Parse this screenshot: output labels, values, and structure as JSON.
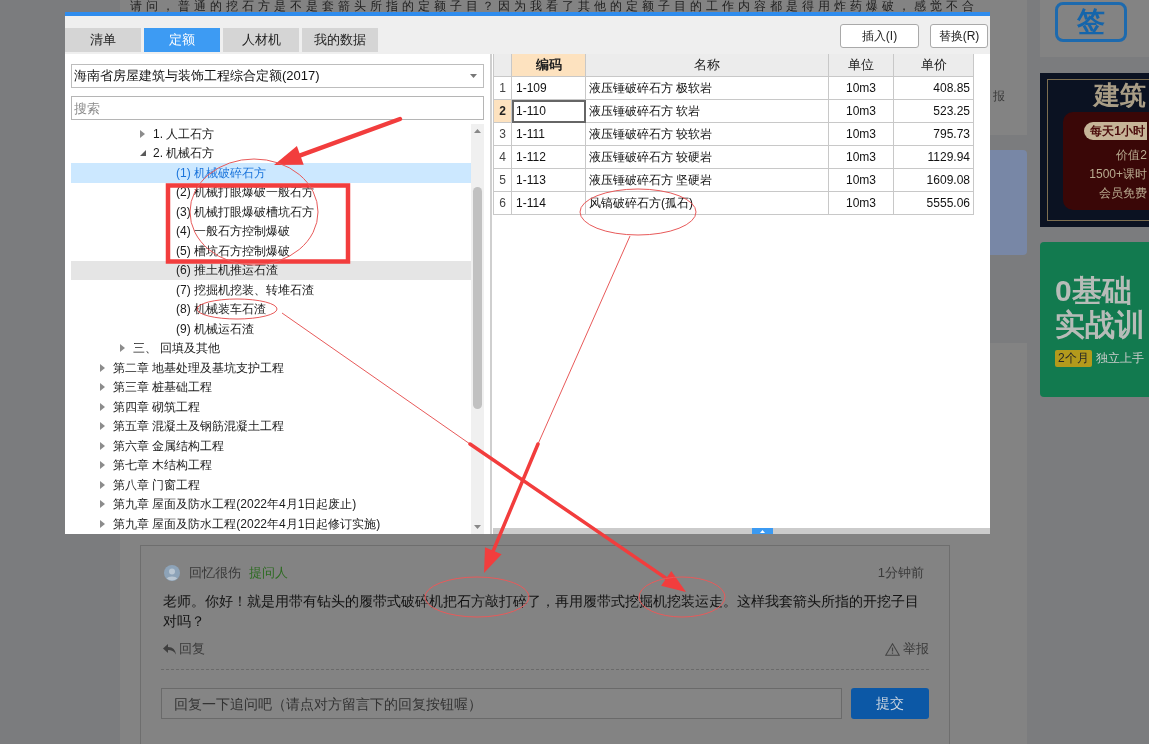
{
  "question": {
    "text": "请问，普通的挖石方是不是套箭头所指的定额子目？因为我看了其他的定额子目的工作内容都是得用炸药爆破，感觉不合",
    "report": "报"
  },
  "sidebar": {
    "sign_in": {
      "label": "签"
    },
    "ads": [
      {
        "kind": "course",
        "title": "建筑",
        "badge": "每天1小时",
        "lines": [
          "价值2",
          "1500+课时",
          "会员免费"
        ]
      },
      {
        "kind": "training",
        "title_lines": [
          "0基础",
          "实战训"
        ],
        "badge": "2个月",
        "subtitle": "独立上手"
      }
    ]
  },
  "screenshot": {
    "tabs": [
      {
        "label": "清单",
        "selected": false
      },
      {
        "label": "定额",
        "selected": true
      },
      {
        "label": "人材机",
        "selected": false
      },
      {
        "label": "我的数据",
        "selected": false
      }
    ],
    "buttons": [
      "插入(I)",
      "替换(R)"
    ],
    "quota_library": {
      "value": "海南省房屋建筑与装饰工程综合定额(2017)"
    },
    "search": {
      "placeholder": "搜索"
    },
    "tree": [
      {
        "children": [
          {
            "children": [
              {
                "label": "1. 人工石方",
                "expanded": false,
                "selected": false,
                "hovered": false
              },
              {
                "label": "2. 机械石方",
                "expanded": true,
                "selected": false,
                "hovered": false,
                "children": [
                  {
                    "label": "(1) 机械破碎石方",
                    "selected": true,
                    "hovered": false
                  },
                  {
                    "label": "(2) 机械打眼爆破一般石方",
                    "selected": false,
                    "hovered": false
                  },
                  {
                    "label": "(3) 机械打眼爆破槽坑石方",
                    "selected": false,
                    "hovered": false
                  },
                  {
                    "label": "(4) 一般石方控制爆破",
                    "selected": false,
                    "hovered": false
                  },
                  {
                    "label": "(5) 槽坑石方控制爆破",
                    "selected": false,
                    "hovered": false
                  },
                  {
                    "label": "(6) 推土机推运石渣",
                    "selected": false,
                    "hovered": true
                  },
                  {
                    "label": "(7) 挖掘机挖装、转堆石渣",
                    "selected": false,
                    "hovered": false
                  },
                  {
                    "label": "(8) 机械装车石渣",
                    "selected": false,
                    "hovered": false
                  },
                  {
                    "label": "(9) 机械运石渣",
                    "selected": false,
                    "hovered": false
                  }
                ]
              }
            ]
          },
          {
            "label": "三、 回填及其他",
            "expanded": false,
            "selected": false,
            "hovered": false
          }
        ]
      },
      {
        "label": "第二章 地基处理及基坑支护工程",
        "expanded": false,
        "selected": false,
        "hovered": false
      },
      {
        "label": "第三章 桩基础工程",
        "expanded": false,
        "selected": false,
        "hovered": false
      },
      {
        "label": "第四章 砌筑工程",
        "expanded": false,
        "selected": false,
        "hovered": false
      },
      {
        "label": "第五章 混凝土及钢筋混凝土工程",
        "expanded": false,
        "selected": false,
        "hovered": false
      },
      {
        "label": "第六章 金属结构工程",
        "expanded": false,
        "selected": false,
        "hovered": false
      },
      {
        "label": "第七章 木结构工程",
        "expanded": false,
        "selected": false,
        "hovered": false
      },
      {
        "label": "第八章 门窗工程",
        "expanded": false,
        "selected": false,
        "hovered": false
      },
      {
        "label": "第九章 屋面及防水工程(2022年4月1日起废止)",
        "expanded": false,
        "selected": false,
        "hovered": false
      },
      {
        "label": "第九章 屋面及防水工程(2022年4月1日起修订实施)",
        "expanded": false,
        "selected": false,
        "hovered": false
      }
    ],
    "table": {
      "columns": [
        {
          "label": "编码",
          "selected": true
        },
        {
          "label": "名称",
          "selected": false
        },
        {
          "label": "单位",
          "selected": false
        },
        {
          "label": "单价",
          "selected": false
        }
      ],
      "rows": [
        {
          "number": "1",
          "code": "1-109",
          "name": "液压锤破碎石方 极软岩",
          "unit": "10m3",
          "price": "408.85",
          "selected": false
        },
        {
          "number": "2",
          "code": "1-110",
          "name": "液压锤破碎石方 软岩",
          "unit": "10m3",
          "price": "523.25",
          "selected": true
        },
        {
          "number": "3",
          "code": "1-111",
          "name": "液压锤破碎石方 较软岩",
          "unit": "10m3",
          "price": "795.73",
          "selected": false
        },
        {
          "number": "4",
          "code": "1-112",
          "name": "液压锤破碎石方 较硬岩",
          "unit": "10m3",
          "price": "1129.94",
          "selected": false
        },
        {
          "number": "5",
          "code": "1-113",
          "name": "液压锤破碎石方 坚硬岩",
          "unit": "10m3",
          "price": "1609.08",
          "selected": false
        },
        {
          "number": "6",
          "code": "1-114",
          "name": "风镐破碎石方(孤石)",
          "unit": "10m3",
          "price": "5555.06",
          "selected": false
        }
      ]
    }
  },
  "comment": {
    "author": "回忆很伤",
    "role": "提问人",
    "time": "1分钟前",
    "text": "老师。你好！就是用带有钻头的履带式破碎机把石方敲打碎了，再用履带式挖掘机挖装运走。这样我套箭头所指的开挖子目对吗？",
    "reply": "回复",
    "report": "举报"
  },
  "reply_form": {
    "placeholder": "回复一下追问吧（请点对方留言下的回复按钮喔）",
    "submit": "提交"
  }
}
